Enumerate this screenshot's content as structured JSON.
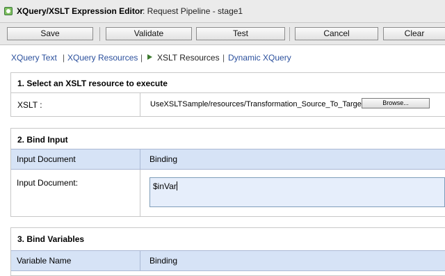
{
  "title": {
    "app": "XQuery/XSLT Expression Editor",
    "context": ": Request Pipeline - stage1"
  },
  "toolbar": {
    "save": "Save",
    "validate": "Validate",
    "test": "Test",
    "cancel": "Cancel",
    "clear": "Clear"
  },
  "nav": {
    "xquery_text": "XQuery Text",
    "xquery_resources": "XQuery Resources",
    "xslt_resources": "XSLT Resources",
    "dynamic_xquery": "Dynamic XQuery",
    "separator": "|"
  },
  "section1": {
    "header": "1. Select an XSLT resource to execute",
    "label": "XSLT :",
    "value": "UseXSLTSample/resources/Transformation_Source_To_Target",
    "browse": "Browse..."
  },
  "section2": {
    "header": "2. Bind Input",
    "col1": "Input Document",
    "col2": "Binding",
    "row_label": "Input Document:",
    "row_value": "$inVar"
  },
  "section3": {
    "header": "3. Bind Variables",
    "col1": "Variable Name",
    "col2": "Binding"
  },
  "colors": {
    "link": "#2a4f9c",
    "table_header_bg": "#d6e3f6",
    "current_arrow": "#3c7a2e"
  }
}
